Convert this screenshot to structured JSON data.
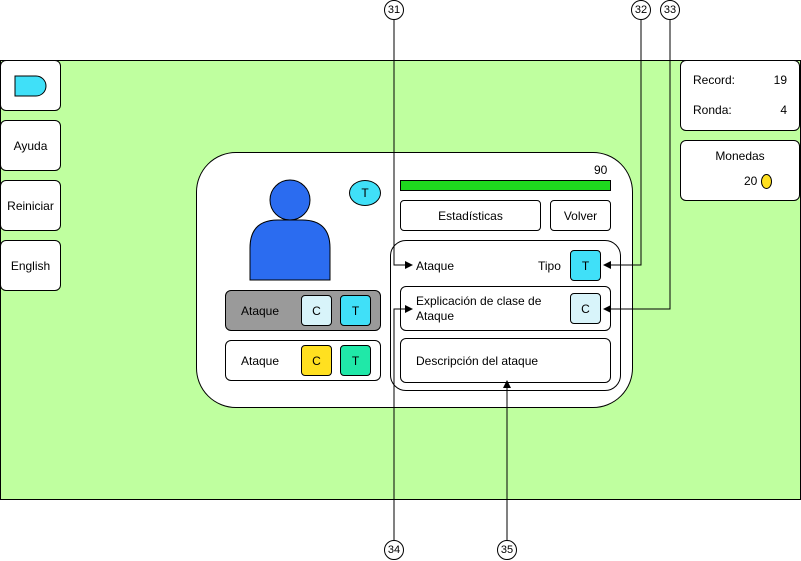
{
  "left_menu": {
    "help_label": "Ayuda",
    "restart_label": "Reiniciar",
    "language_label": "English"
  },
  "stats": {
    "record_label": "Record:",
    "record_value": "19",
    "round_label": "Ronda:",
    "round_value": "4"
  },
  "coins": {
    "title": "Monedas",
    "value": "20"
  },
  "card": {
    "type_badge": "T",
    "health_value": "90",
    "health_fraction": 1.0,
    "stats_button": "Estadísticas",
    "back_button": "Volver",
    "attacks": [
      {
        "label": "Ataque",
        "class_chip": "C",
        "type_chip": "T",
        "selected": true
      },
      {
        "label": "Ataque",
        "class_chip": "C",
        "type_chip": "T",
        "selected": false
      }
    ],
    "detail": {
      "attack_name": "Ataque",
      "type_label": "Tipo",
      "type_chip": "T",
      "class_explanation": "Explicación de clase de Ataque",
      "class_chip": "C",
      "description": "Descripción del ataque"
    }
  },
  "callouts": {
    "c31": "31",
    "c32": "32",
    "c33": "33",
    "c34": "34",
    "c35": "35"
  },
  "colors": {
    "board": "#bfff9f",
    "avatar": "#2b6cf0",
    "health_bar": "#1ed81e",
    "type_cyan": "#40e0f8",
    "class_light": "#d8f4fa",
    "class_yellow": "#ffe020",
    "type_green": "#20e8a8",
    "selected_row": "#9a9a9a"
  }
}
